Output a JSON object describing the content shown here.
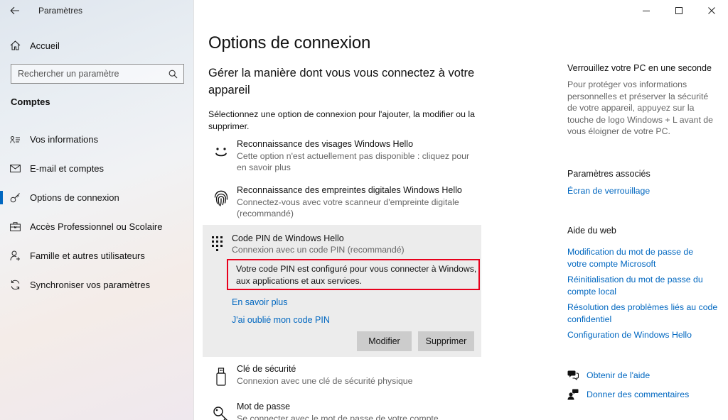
{
  "window": {
    "title": "Paramètres",
    "controls": [
      "minimize-icon",
      "maximize-icon",
      "close-icon"
    ]
  },
  "sidebar": {
    "home_label": "Accueil",
    "search_placeholder": "Rechercher un paramètre",
    "section_title": "Comptes",
    "items": [
      {
        "label": "Vos informations",
        "icon": "person-card-icon"
      },
      {
        "label": "E-mail et comptes",
        "icon": "mail-icon"
      },
      {
        "label": "Options de connexion",
        "icon": "key-icon",
        "active": true
      },
      {
        "label": "Accès Professionnel ou Scolaire",
        "icon": "briefcase-icon"
      },
      {
        "label": "Famille et autres utilisateurs",
        "icon": "person-add-icon"
      },
      {
        "label": "Synchroniser vos paramètres",
        "icon": "sync-icon"
      }
    ],
    "accent": "#0067c0"
  },
  "main": {
    "title": "Options de connexion",
    "subtitle": "Gérer la manière dont vous vous connectez à votre appareil",
    "description": "Sélectionnez une option de connexion pour l'ajouter, la modifier ou la supprimer.",
    "options": [
      {
        "title": "Reconnaissance des visages Windows Hello",
        "subtitle": "Cette option n'est actuellement pas disponible : cliquez pour en savoir plus",
        "icon": "face-icon"
      },
      {
        "title": "Reconnaissance des empreintes digitales Windows Hello",
        "subtitle": "Connectez-vous avec votre scanneur d'empreinte digitale (recommandé)",
        "icon": "fingerprint-icon"
      },
      {
        "title": "Code PIN de Windows Hello",
        "subtitle": "Connexion avec un code PIN (recommandé)",
        "icon": "keypad-icon"
      },
      {
        "title": "Clé de sécurité",
        "subtitle": "Connexion avec une clé de sécurité physique",
        "icon": "usb-key-icon"
      },
      {
        "title": "Mot de passe",
        "subtitle": "Se connecter avec le mot de passe de votre compte",
        "icon": "key-icon"
      }
    ],
    "pin": {
      "note": "Votre code PIN est configuré pour vous connecter à Windows, aux applications et aux services.",
      "learn_more": "En savoir plus",
      "forgot": "J'ai oublié mon code PIN",
      "modify_label": "Modifier",
      "delete_label": "Supprimer",
      "highlight_color": "#e8001c"
    }
  },
  "right": {
    "lock_title": "Verrouillez votre PC en une seconde",
    "lock_text": "Pour protéger vos informations personnelles et préserver la sécurité de votre appareil, appuyez sur la touche de logo Windows + L avant de vous éloigner de votre PC.",
    "related_title": "Paramètres associés",
    "related_links": [
      "Écran de verrouillage"
    ],
    "web_help_title": "Aide du web",
    "web_links": [
      "Modification du mot de passe de votre compte Microsoft",
      "Réinitialisation du mot de passe du compte local",
      "Résolution des problèmes liés au code confidentiel",
      "Configuration de Windows Hello"
    ],
    "get_help": "Obtenir de l'aide",
    "feedback": "Donner des commentaires"
  }
}
